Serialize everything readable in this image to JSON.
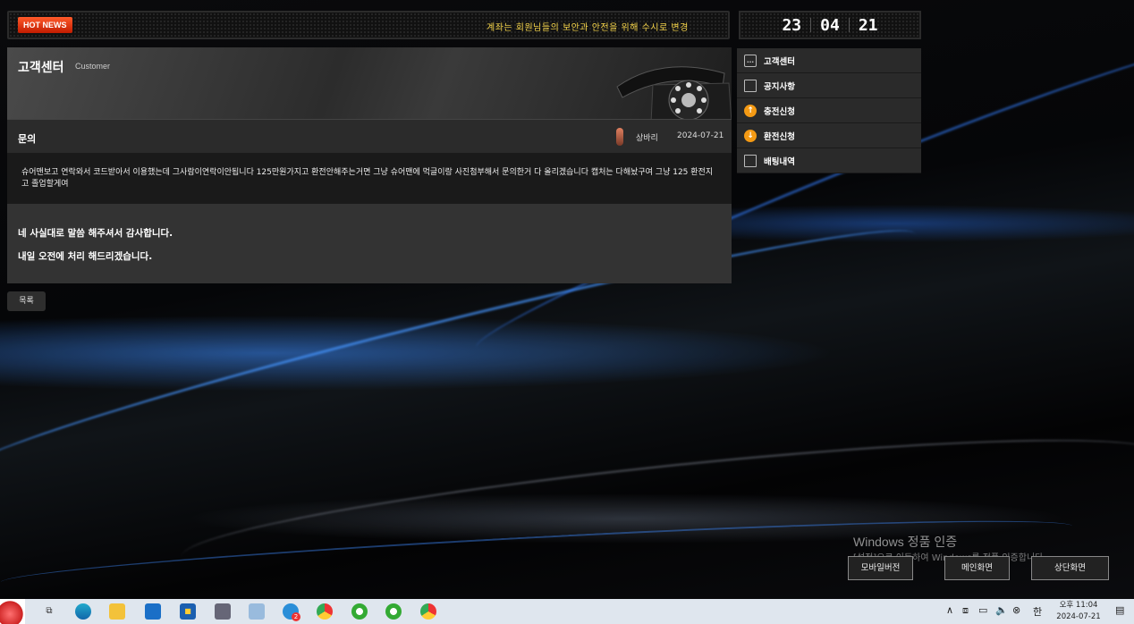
{
  "top": {
    "news_badge": "HOT NEWS",
    "news_text": "계좌는 회원님들의 보안과 안전을 위해 수시로 변경",
    "clock": {
      "h": "23",
      "m": "04",
      "s": "21"
    }
  },
  "header": {
    "title": "고객센터",
    "subtitle": "Customer"
  },
  "post": {
    "title": "문의",
    "author": "상바리",
    "date": "2024-07-21",
    "body": "슈어맨보고 연락와서 코드받아서 이용했는데 그사람이연락이안됩니다 125만원가지고 환전안해주는거면 그냥 슈어맨에 먹글이랑 사진첨부해서 문의한거 다 올리겠습니다 캡처는 다해놨구여 그냥 125 환전지고 졸업할게여"
  },
  "reply": {
    "line1": "네 사실대로 말씀 해주셔서 감사합니다.",
    "line2": "내일 오전에 처리 해드리겠습니다."
  },
  "list_button": "목록",
  "side_menu": [
    {
      "label": "고객센터",
      "icon": "chat-icon"
    },
    {
      "label": "공지사항",
      "icon": "document-icon"
    },
    {
      "label": "충전신청",
      "icon": "arrow-up-icon"
    },
    {
      "label": "환전신청",
      "icon": "arrow-down-icon"
    },
    {
      "label": "배팅내역",
      "icon": "document-icon"
    }
  ],
  "watermark": {
    "line1": "Windows 정품 인증",
    "line2": "[설정]으로 이동하여 Windows를 정품 인증합니다."
  },
  "bottom_buttons": {
    "mobile": "모바일버전",
    "main": "메인화면",
    "top": "상단화면"
  },
  "taskbar": {
    "time": "오후 11:04",
    "date": "2024-07-21",
    "ime": "한",
    "chrome_badge": "2"
  }
}
